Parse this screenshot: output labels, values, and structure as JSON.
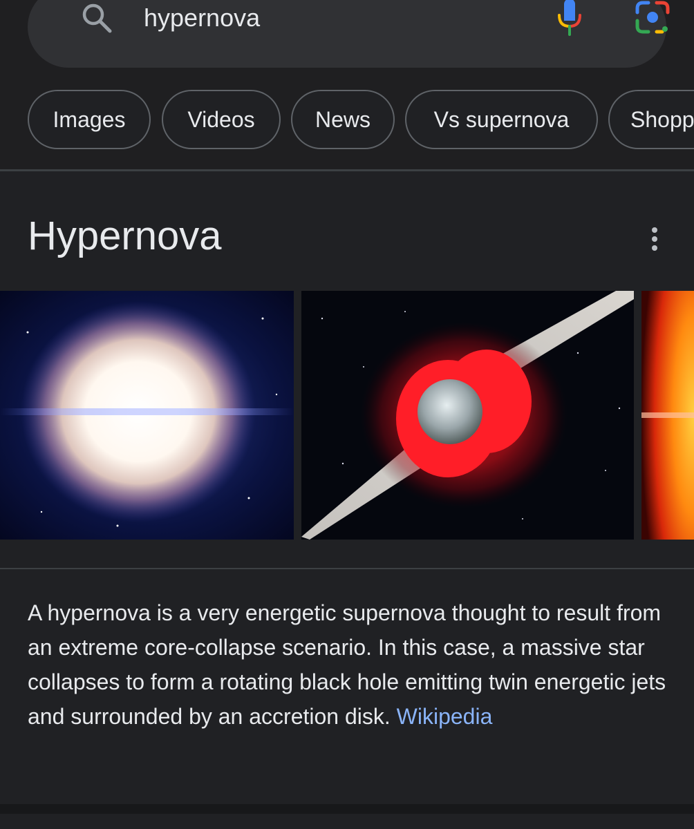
{
  "search": {
    "query": "hypernova"
  },
  "chips": [
    {
      "label": "Images"
    },
    {
      "label": "Videos"
    },
    {
      "label": "News"
    },
    {
      "label": "Vs supernova"
    },
    {
      "label": "Shopping"
    }
  ],
  "knowledge_panel": {
    "title": "Hypernova",
    "description": "A hypernova is a very energetic supernova thought to result from an extreme core-collapse scenario. In this case, a massive star collapses to form a rotating black hole emitting twin energetic jets and surrounded by an accretion disk.",
    "source_link": "Wikipedia"
  },
  "colors": {
    "background": "#202124",
    "search_bar": "#303134",
    "chip_border": "#5f6368",
    "link": "#8ab4f8",
    "text": "#e8eaed"
  },
  "icons": [
    "search-icon",
    "mic-icon",
    "lens-icon",
    "more-vert-icon"
  ]
}
